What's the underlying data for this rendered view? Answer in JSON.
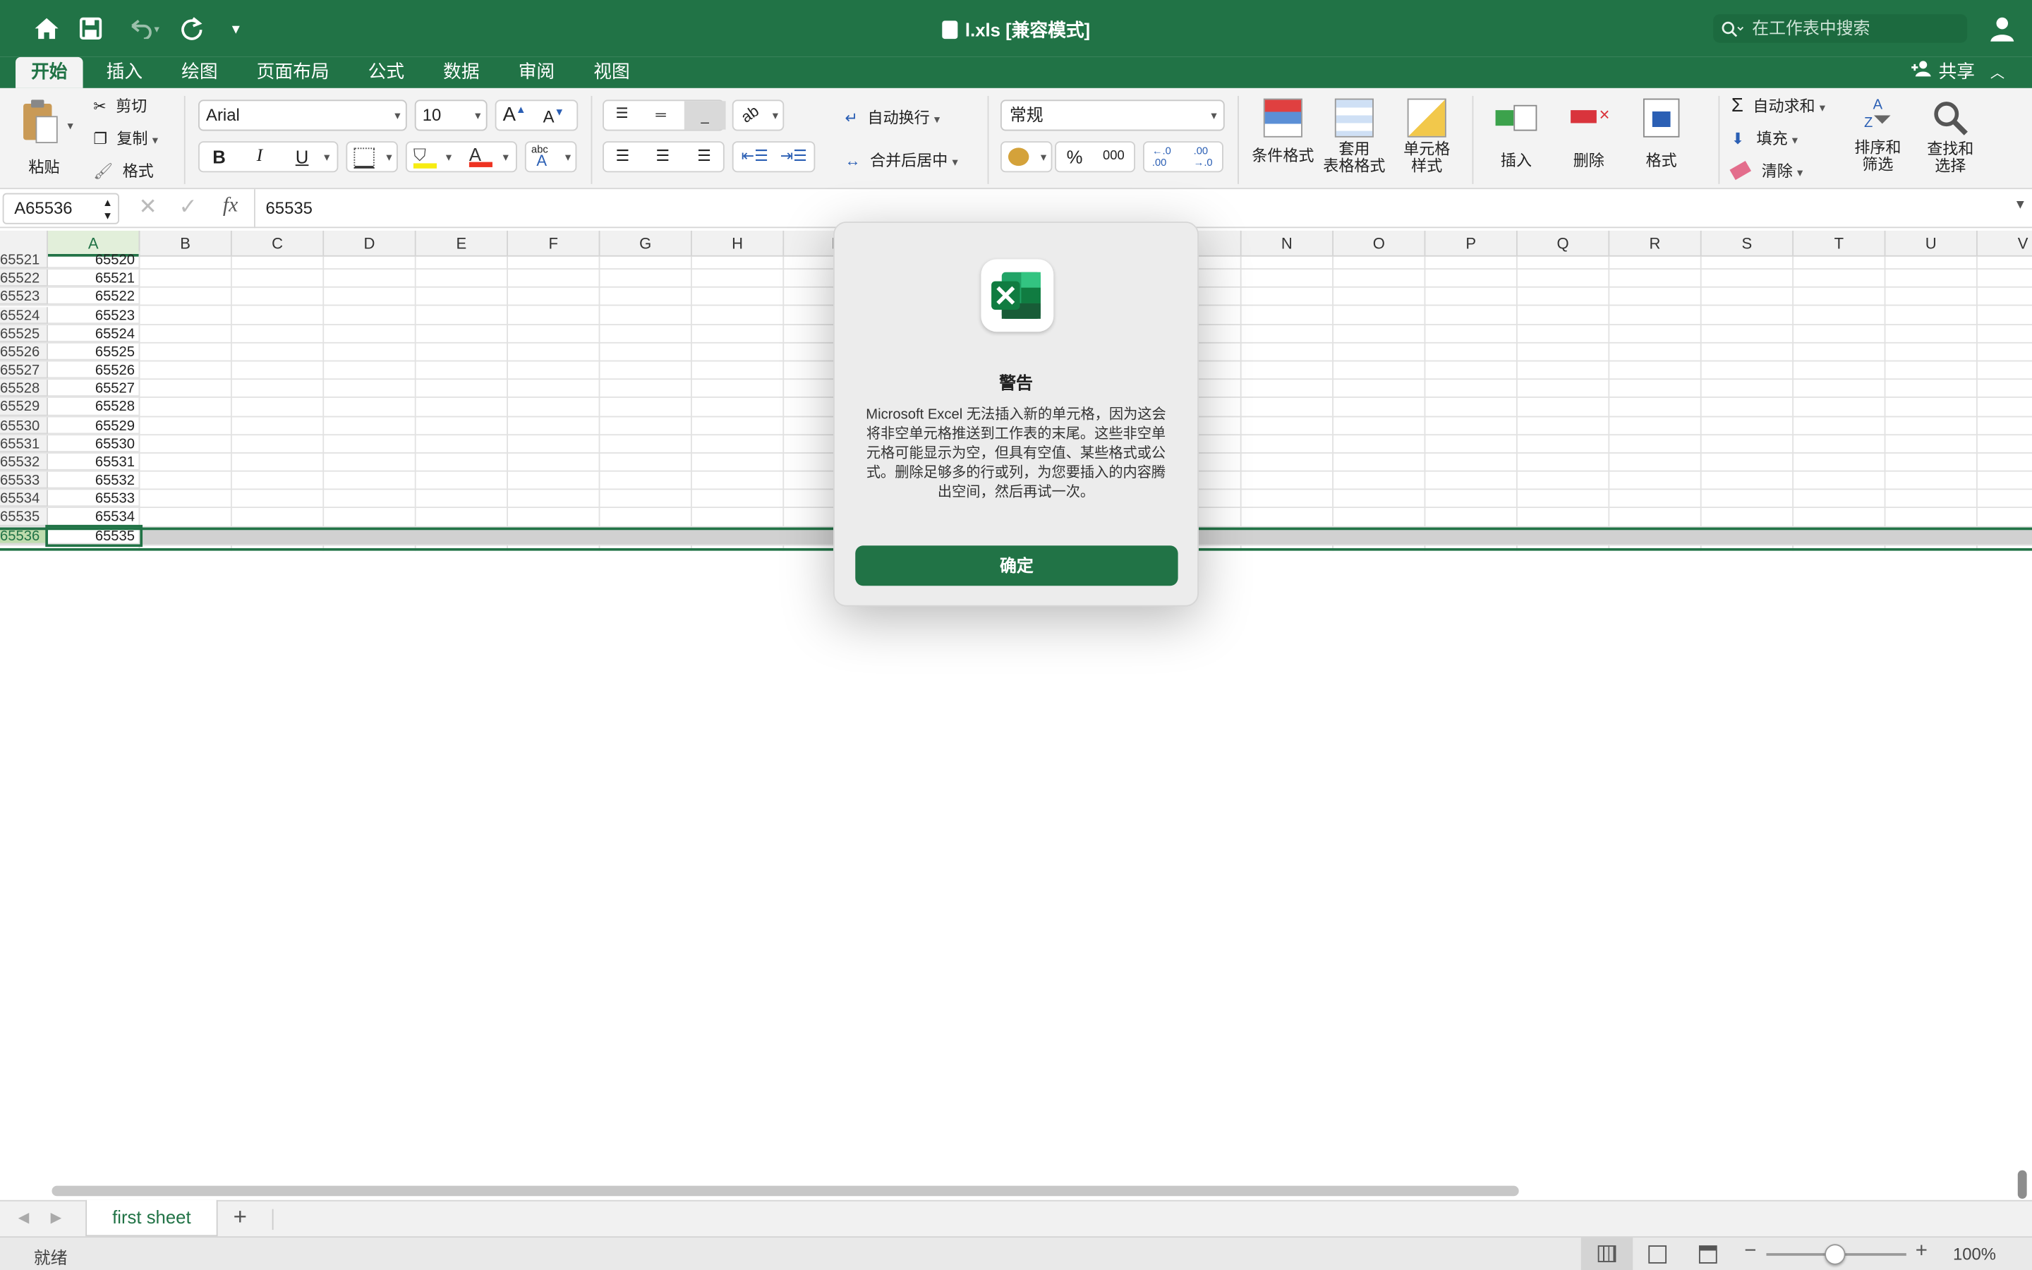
{
  "titlebar": {
    "title": "l.xls [兼容模式]",
    "search_placeholder": "在工作表中搜索"
  },
  "tabs": [
    {
      "label": "开始",
      "active": true
    },
    {
      "label": "插入"
    },
    {
      "label": "绘图"
    },
    {
      "label": "页面布局"
    },
    {
      "label": "公式"
    },
    {
      "label": "数据"
    },
    {
      "label": "审阅"
    },
    {
      "label": "视图"
    }
  ],
  "share_label": "共享",
  "ribbon": {
    "paste": "粘贴",
    "cut": "剪切",
    "copy": "复制",
    "format_painter": "格式",
    "font_name": "Arial",
    "font_size": "10",
    "bold": "B",
    "italic": "I",
    "underline": "U",
    "wrap_text": "自动换行",
    "merge_center": "合并后居中",
    "number_format": "常规",
    "percent": "%",
    "thousands": "000",
    "cond_format": "条件格式",
    "table_format_1": "套用",
    "table_format_2": "表格格式",
    "cell_style_1": "单元格",
    "cell_style_2": "样式",
    "insert": "插入",
    "delete": "删除",
    "format": "格式",
    "autosum": "自动求和",
    "fill": "填充",
    "clear": "清除",
    "sort_1": "排序和",
    "sort_2": "筛选",
    "find_1": "查找和",
    "find_2": "选择"
  },
  "formula_bar": {
    "name_box": "A65536",
    "fx": "fx",
    "value": "65535"
  },
  "columns": [
    "A",
    "B",
    "C",
    "D",
    "E",
    "F",
    "G",
    "H",
    "I",
    "",
    "",
    "",
    "",
    "N",
    "O",
    "P",
    "Q",
    "R",
    "S",
    "T",
    "U",
    "V"
  ],
  "rows": [
    {
      "num": "65521",
      "a": "65520"
    },
    {
      "num": "65522",
      "a": "65521"
    },
    {
      "num": "65523",
      "a": "65522"
    },
    {
      "num": "65524",
      "a": "65523"
    },
    {
      "num": "65525",
      "a": "65524"
    },
    {
      "num": "65526",
      "a": "65525"
    },
    {
      "num": "65527",
      "a": "65526"
    },
    {
      "num": "65528",
      "a": "65527"
    },
    {
      "num": "65529",
      "a": "65528"
    },
    {
      "num": "65530",
      "a": "65529"
    },
    {
      "num": "65531",
      "a": "65530"
    },
    {
      "num": "65532",
      "a": "65531"
    },
    {
      "num": "65533",
      "a": "65532"
    },
    {
      "num": "65534",
      "a": "65533"
    },
    {
      "num": "65535",
      "a": "65534"
    },
    {
      "num": "65536",
      "a": "65535",
      "selected": true
    }
  ],
  "dialog": {
    "title": "警告",
    "message": "Microsoft Excel 无法插入新的单元格，因为这会将非空单元格推送到工作表的末尾。这些非空单元格可能显示为空，但具有空值、某些格式或公式。删除足够多的行或列，为您要插入的内容腾出空间，然后再试一次。",
    "ok": "确定"
  },
  "sheet_tab": "first sheet",
  "status": {
    "ready": "就绪",
    "zoom": "100%"
  },
  "colors": {
    "accent": "#217346",
    "accent_light": "#e2efda"
  }
}
